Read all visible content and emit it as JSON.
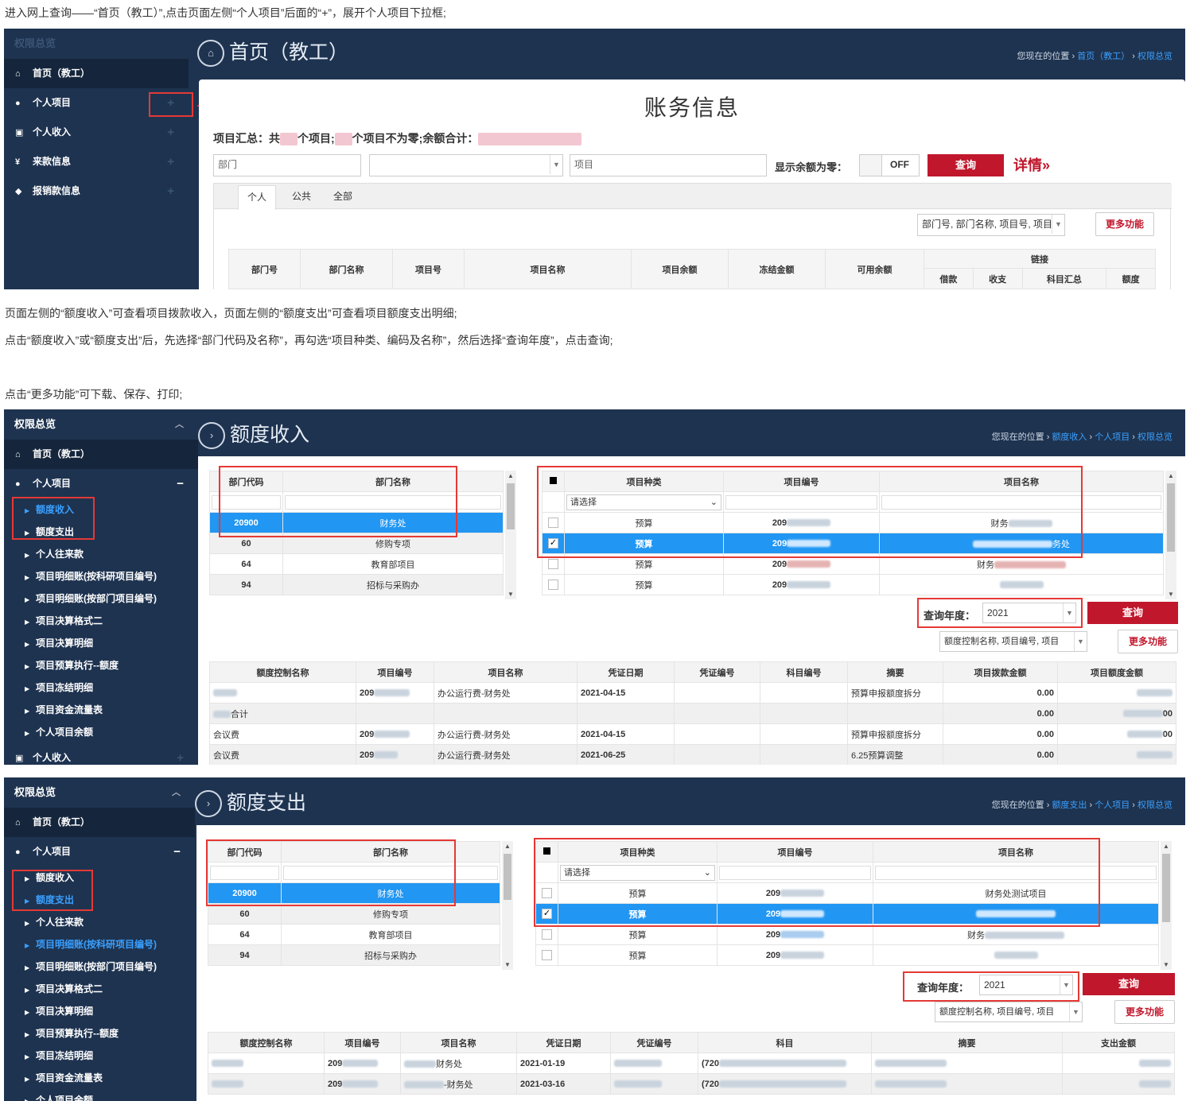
{
  "instructions": {
    "p1": "进入网上查询——“首页（教工）”,点击页面左侧“个人项目”后面的“+”，展开个人项目下拉框;",
    "p2": "页面左侧的“额度收入”可查看项目拨款收入，页面左侧的“额度支出”可查看项目额度支出明细;",
    "p3": "点击“额度收入”或“额度支出”后，先选择“部门代码及名称”，再勾选“项目种类、编码及名称”，然后选择“查询年度”，点击查询;",
    "p4": "点击“更多功能”可下载、保存、打印;"
  },
  "shot1": {
    "sidebar": {
      "header": "权限总览",
      "items": [
        {
          "label": "首页（教工）",
          "icon": "home-icon"
        },
        {
          "label": "个人项目",
          "icon": "user-icon"
        },
        {
          "label": "个人收入",
          "icon": "money-icon"
        },
        {
          "label": "来款信息",
          "icon": "yen-icon"
        },
        {
          "label": "报销款信息",
          "icon": "tag-icon"
        }
      ],
      "plus": "+"
    },
    "page_title": "首页（教工）",
    "crumb": {
      "prefix": "您现在的位置 › ",
      "a": "首页（教工）",
      "sep": " › ",
      "b": "权限总览"
    },
    "section_title": "账务信息",
    "summary": {
      "a": "项目汇总：共",
      "b": "个项目;",
      "c": "个项目不为零;余额合计："
    },
    "filter": {
      "dept_placeholder": "部门",
      "project_placeholder": "项目",
      "zero_label": "显示余额为零：",
      "toggle": "OFF",
      "query": "查询",
      "detail": "详情»"
    },
    "tabs": [
      "个人",
      "公共",
      "全部"
    ],
    "columns_select": "部门号, 部门名称, 项目号, 项目",
    "more": "更多功能",
    "table_headers": [
      "部门号",
      "部门名称",
      "项目号",
      "项目名称",
      "项目余额",
      "冻结金额",
      "可用余额"
    ],
    "link_header": "链接",
    "link_sub": [
      "借款",
      "收支",
      "科目汇总",
      "额度"
    ]
  },
  "shot2": {
    "sidebar": {
      "header": "权限总览",
      "home": "首页（教工）",
      "personal": "个人项目",
      "minus": "−",
      "subs": [
        "额度收入",
        "额度支出",
        "个人往来款",
        "项目明细账(按科研项目编号)",
        "项目明细账(按部门项目编号)",
        "项目决算格式二",
        "项目决算明细",
        "项目预算执行--额度",
        "项目冻结明细",
        "项目资金流量表",
        "个人项目余额"
      ],
      "income": "个人收入",
      "plus": "+"
    },
    "page_title": "额度收入",
    "crumb": {
      "prefix": "您现在的位置 › ",
      "a": "额度收入",
      "b": "个人项目",
      "c": "权限总览"
    },
    "dept_table": {
      "headers": [
        "部门代码",
        "部门名称"
      ],
      "rows": [
        [
          "20900",
          "财务处"
        ],
        [
          "60",
          "修购专项"
        ],
        [
          "64",
          "教育部项目"
        ],
        [
          "94",
          "招标与采购办"
        ]
      ]
    },
    "proj_table": {
      "headers": [
        "项目种类",
        "项目编号",
        "项目名称"
      ],
      "select_placeholder": "请选择",
      "rows": [
        {
          "type": "预算",
          "code": "209",
          "name": "财务"
        },
        {
          "type": "预算",
          "code": "209",
          "name": "务处"
        },
        {
          "type": "预算",
          "code": "209",
          "name": "财务"
        },
        {
          "type": "预算",
          "code": "209",
          "name": ""
        }
      ],
      "check": "✓"
    },
    "year_label": "查询年度：",
    "year_value": "2021",
    "query": "查询",
    "columns_select": "额度控制名称, 项目编号, 项目",
    "more": "更多功能",
    "result_headers": [
      "额度控制名称",
      "项目编号",
      "项目名称",
      "凭证日期",
      "凭证编号",
      "科目编号",
      "摘要",
      "项目拨款金额",
      "项目额度金额"
    ],
    "result_rows": [
      {
        "ctrl": "",
        "code": "209",
        "name": "办公运行费-财务处",
        "date": "2021-04-15",
        "memo": "预算申报额度拆分",
        "amt": "0.00"
      },
      {
        "ctrl": "合计",
        "code": "",
        "name": "",
        "date": "",
        "memo": "",
        "amt": "0.00"
      },
      {
        "ctrl": "会议费",
        "code": "209",
        "name": "办公运行费-财务处",
        "date": "2021-04-15",
        "memo": "预算申报额度拆分",
        "amt": "0.00"
      },
      {
        "ctrl": "会议费",
        "code": "209",
        "name": "办公运行费-财务处",
        "date": "2021-06-25",
        "memo": "6.25预算调整",
        "amt": "0.00"
      }
    ],
    "quota_tail": [
      "",
      "00",
      "00",
      ""
    ]
  },
  "shot3": {
    "sidebar": {
      "header": "权限总览",
      "home": "首页（教工）",
      "personal": "个人项目",
      "minus": "−",
      "subs": [
        "额度收入",
        "额度支出",
        "个人往来款",
        "项目明细账(按科研项目编号)",
        "项目明细账(按部门项目编号)",
        "项目决算格式二",
        "项目决算明细",
        "项目预算执行--额度",
        "项目冻结明细",
        "项目资金流量表",
        "个人项目余额"
      ]
    },
    "page_title": "额度支出",
    "crumb": {
      "prefix": "您现在的位置 › ",
      "a": "额度支出",
      "b": "个人项目",
      "c": "权限总览"
    },
    "dept_table": {
      "headers": [
        "部门代码",
        "部门名称"
      ],
      "rows": [
        [
          "20900",
          "财务处"
        ],
        [
          "60",
          "修购专项"
        ],
        [
          "64",
          "教育部项目"
        ],
        [
          "94",
          "招标与采购办"
        ]
      ]
    },
    "proj_table": {
      "headers": [
        "项目种类",
        "项目编号",
        "项目名称"
      ],
      "select_placeholder": "请选择",
      "rows": [
        {
          "type": "预算",
          "code": "209",
          "name": "财务处测试项目"
        },
        {
          "type": "预算",
          "code": "209",
          "name": ""
        },
        {
          "type": "预算",
          "code": "209",
          "name": "财务"
        },
        {
          "type": "预算",
          "code": "209",
          "name": ""
        }
      ],
      "check": "✓"
    },
    "year_label": "查询年度：",
    "year_value": "2021",
    "query": "查询",
    "columns_select": "额度控制名称, 项目编号, 项目",
    "more": "更多功能",
    "result_headers": [
      "额度控制名称",
      "项目编号",
      "项目名称",
      "凭证日期",
      "凭证编号",
      "科目",
      "摘要",
      "支出金额"
    ],
    "result_rows": [
      {
        "code": "209",
        "name": "财务处",
        "date": "2021-01-19",
        "subj": "(720"
      },
      {
        "code": "209",
        "name": "-财务处",
        "date": "2021-03-16",
        "subj": "(720"
      }
    ]
  }
}
